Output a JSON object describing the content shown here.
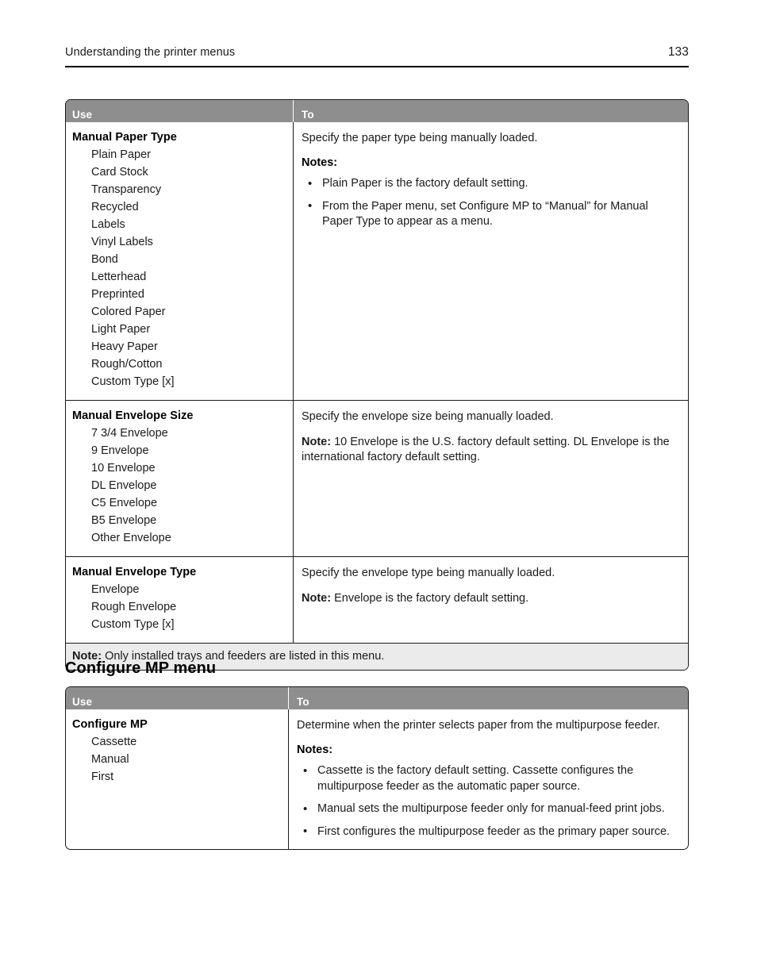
{
  "header": {
    "title": "Understanding the printer menus",
    "page_number": "133"
  },
  "table1": {
    "columns": {
      "use": "Use",
      "to": "To"
    },
    "rows": [
      {
        "option_title": "Manual Paper Type",
        "options": [
          "Plain Paper",
          "Card Stock",
          "Transparency",
          "Recycled",
          "Labels",
          "Vinyl Labels",
          "Bond",
          "Letterhead",
          "Preprinted",
          "Colored Paper",
          "Light Paper",
          "Heavy Paper",
          "Rough/Cotton",
          "Custom Type [x]"
        ],
        "description": "Specify the paper type being manually loaded.",
        "notes_label": "Notes:",
        "bullets": [
          "Plain Paper is the factory default setting.",
          "From the Paper menu, set Configure MP to “Manual” for Manual Paper Type to appear as a menu."
        ]
      },
      {
        "option_title": "Manual Envelope Size",
        "options": [
          "7 3/4 Envelope",
          "9 Envelope",
          "10 Envelope",
          "DL Envelope",
          "C5 Envelope",
          "B5 Envelope",
          "Other Envelope"
        ],
        "description": "Specify the envelope size being manually loaded.",
        "note_label": "Note:",
        "note_text": " 10 Envelope is the U.S. factory default setting. DL Envelope is the international factory default setting."
      },
      {
        "option_title": "Manual Envelope Type",
        "options": [
          "Envelope",
          "Rough Envelope",
          "Custom Type [x]"
        ],
        "description": "Specify the envelope type being manually loaded.",
        "note_label": "Note:",
        "note_text": " Envelope is the factory default setting."
      }
    ],
    "footnote_label": "Note:",
    "footnote_text": " Only installed trays and feeders are listed in this menu."
  },
  "section2": {
    "heading": "Configure MP menu"
  },
  "table2": {
    "columns": {
      "use": "Use",
      "to": "To"
    },
    "rows": [
      {
        "option_title": "Configure MP",
        "options": [
          "Cassette",
          "Manual",
          "First"
        ],
        "description": "Determine when the printer selects paper from the multipurpose feeder.",
        "notes_label": "Notes:",
        "bullets": [
          "Cassette is the factory default setting. Cassette configures the multipurpose feeder as the automatic paper source.",
          "Manual sets the multipurpose feeder only for manual-feed print jobs.",
          "First configures the multipurpose feeder as the primary paper source."
        ]
      }
    ]
  },
  "colors": {
    "table_header_bg": "#8e8e8e",
    "footnote_bg": "#ebebeb",
    "border": "#1a1a1a",
    "text": "#1a1a1a"
  }
}
